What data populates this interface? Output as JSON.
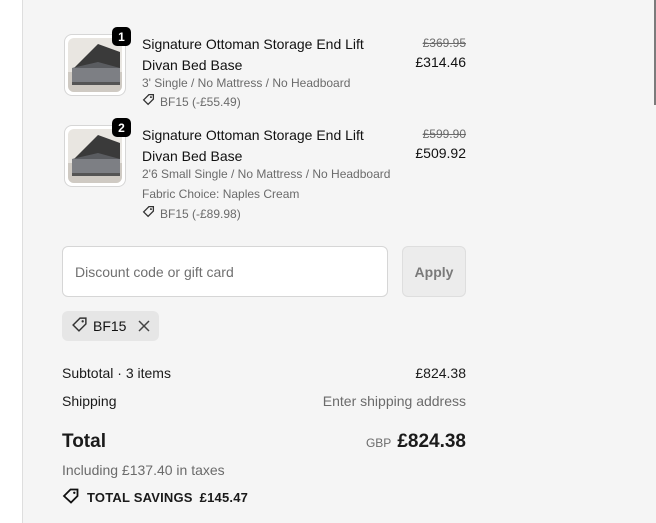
{
  "items": [
    {
      "quantity": "1",
      "name": "Signature Ottoman Storage End Lift Divan Bed Base",
      "variant": "3' Single / No Mattress / No Headboard",
      "fabric": "",
      "discount": "BF15 (-£55.49)",
      "original_price": "£369.95",
      "price": "£314.46"
    },
    {
      "quantity": "2",
      "name": "Signature Ottoman Storage End Lift Divan Bed Base",
      "variant": "2'6 Small Single / No Mattress / No Headboard",
      "fabric": "Fabric Choice: Naples Cream",
      "discount": "BF15 (-£89.98)",
      "original_price": "£599.90",
      "price": "£509.92"
    }
  ],
  "discount_form": {
    "placeholder": "Discount code or gift card",
    "value": "",
    "apply_label": "Apply"
  },
  "applied_code": {
    "label": "BF15"
  },
  "summary": {
    "subtotal_label": "Subtotal · 3 items",
    "subtotal_value": "£824.38",
    "shipping_label": "Shipping",
    "shipping_value": "Enter shipping address",
    "total_label": "Total",
    "currency": "GBP",
    "total_value": "£824.38",
    "taxes_note": "Including £137.40 in taxes",
    "savings_label": "TOTAL SAVINGS",
    "savings_value": "£145.47"
  },
  "colors": {
    "panel_bg": "#f5f5f5",
    "badge_bg": "#000000",
    "muted_text": "#6b6b6b"
  },
  "icons": [
    "tag-icon",
    "close-icon",
    "product-thumbnail"
  ]
}
